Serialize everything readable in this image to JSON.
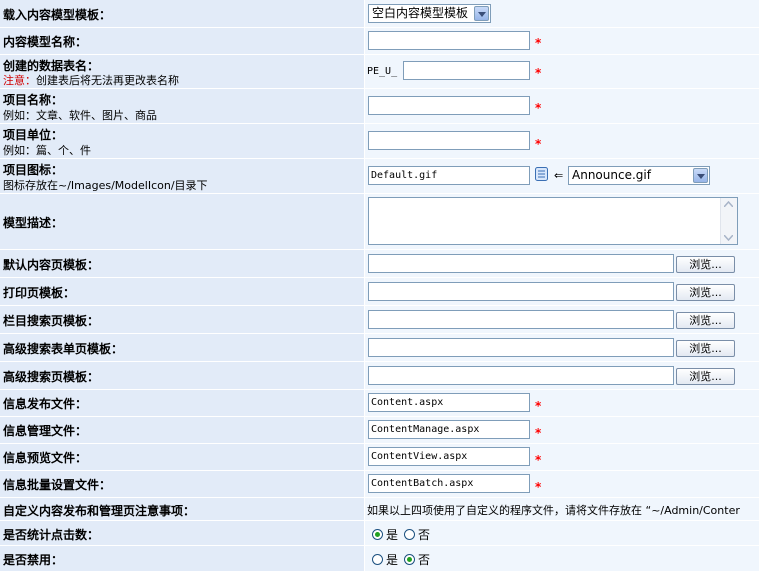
{
  "rows": [
    {
      "label": "载入内容模型模板："
    },
    {
      "label": "内容模型名称："
    },
    {
      "label": "创建的数据表名：",
      "note_prefix": "注意：",
      "note": "创建表后将无法再更改表名称"
    },
    {
      "label": "项目名称：",
      "sub": "例如：文章、软件、图片、商品"
    },
    {
      "label": "项目单位：",
      "sub": "例如：篇、个、件"
    },
    {
      "label": "项目图标：",
      "sub": "图标存放在~/Images/ModelIcon/目录下"
    },
    {
      "label": "模型描述："
    },
    {
      "label": "默认内容页模板："
    },
    {
      "label": "打印页模板："
    },
    {
      "label": "栏目搜索页模板："
    },
    {
      "label": "高级搜索表单页模板："
    },
    {
      "label": "高级搜索页模板："
    },
    {
      "label": "信息发布文件："
    },
    {
      "label": "信息管理文件："
    },
    {
      "label": "信息预览文件："
    },
    {
      "label": "信息批量设置文件："
    },
    {
      "label": "自定义内容发布和管理页注意事项："
    },
    {
      "label": "是否统计点击数："
    },
    {
      "label": "是否禁用："
    }
  ],
  "template_select": {
    "value": "空白内容模型模板"
  },
  "table_prefix": "PE_U_",
  "required_mark": "*",
  "icon_input": {
    "value": "Default.gif"
  },
  "icon_arrow": "⇐",
  "icon_select": {
    "value": "Announce.gif"
  },
  "browse_label": "浏览...",
  "files": {
    "publish": "Content.aspx",
    "manage": "ContentManage.aspx",
    "preview": "ContentView.aspx",
    "batch": "ContentBatch.aspx"
  },
  "custom_note": "如果以上四项使用了自定义的程序文件，请将文件存放在 “~/Admin/Conter",
  "yes_label": "是",
  "no_label": "否",
  "click_count": "yes",
  "disabled": "no",
  "colors": {
    "label_bg": "#e2ebf8",
    "field_bg": "#f0f6fd",
    "required": "#ff0000"
  }
}
